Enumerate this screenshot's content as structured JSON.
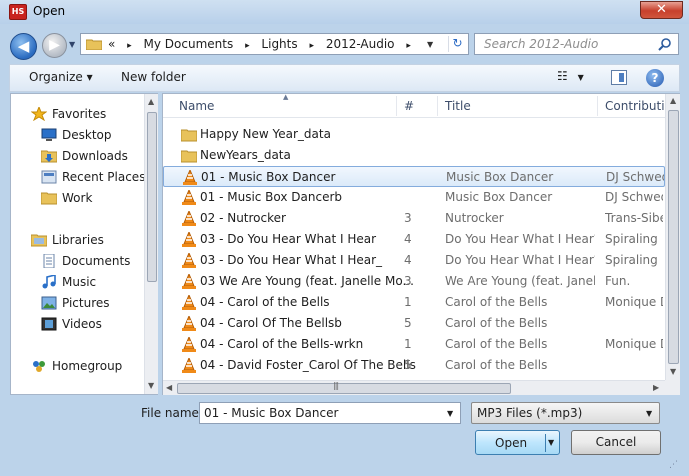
{
  "window": {
    "title": "Open",
    "icon_label": "HS",
    "close_label": "✕"
  },
  "nav": {
    "back_symbol": "◀",
    "forward_symbol": "▶"
  },
  "address": {
    "overflow": "«",
    "crumbs": [
      "My Documents",
      "Lights",
      "2012-Audio"
    ],
    "separator": "▸"
  },
  "search": {
    "placeholder": "Search 2012-Audio"
  },
  "toolbar": {
    "organize": "Organize ▾",
    "new_folder": "New folder",
    "help": "?"
  },
  "sidebar": {
    "items": [
      {
        "label": "Favorites",
        "icon": "star-icon"
      },
      {
        "label": "Desktop",
        "icon": "desktop-icon"
      },
      {
        "label": "Downloads",
        "icon": "downloads-icon"
      },
      {
        "label": "Recent Places",
        "icon": "recent-places-icon"
      },
      {
        "label": "Work",
        "icon": "folder-icon"
      },
      {
        "label": "Libraries",
        "icon": "library-icon"
      },
      {
        "label": "Documents",
        "icon": "documents-icon"
      },
      {
        "label": "Music",
        "icon": "music-icon"
      },
      {
        "label": "Pictures",
        "icon": "pictures-icon"
      },
      {
        "label": "Videos",
        "icon": "videos-icon"
      },
      {
        "label": "Homegroup",
        "icon": "homegroup-icon"
      }
    ]
  },
  "columns": {
    "name": "Name",
    "number": "#",
    "title": "Title",
    "contributing": "Contributin"
  },
  "files": [
    {
      "name": "Happy New Year_data",
      "num": "",
      "title": "",
      "contrib": "",
      "type": "folder"
    },
    {
      "name": "NewYears_data",
      "num": "",
      "title": "",
      "contrib": "",
      "type": "folder"
    },
    {
      "name": "01 - Music Box Dancer",
      "num": "",
      "title": "Music Box Dancer",
      "contrib": "DJ Schwed",
      "type": "audio"
    },
    {
      "name": "01 - Music Box Dancerb",
      "num": "",
      "title": "Music Box Dancer",
      "contrib": "DJ Schwed",
      "type": "audio"
    },
    {
      "name": "02 - Nutrocker",
      "num": "3",
      "title": "Nutrocker",
      "contrib": "Trans-Sibe",
      "type": "audio"
    },
    {
      "name": "03 - Do You Hear What I Hear",
      "num": "4",
      "title": "Do You Hear What I Hear?",
      "contrib": "Spiraling",
      "type": "audio"
    },
    {
      "name": "03 - Do You Hear What I Hear_",
      "num": "4",
      "title": "Do You Hear What I Hear?",
      "contrib": "Spiraling",
      "type": "audio"
    },
    {
      "name": "03 We Are Young (feat. Janelle Mo...",
      "num": "3",
      "title": "We Are Young (feat. Janel...",
      "contrib": "Fun.",
      "type": "audio"
    },
    {
      "name": "04 - Carol of the Bells",
      "num": "1",
      "title": "Carol of the Bells",
      "contrib": "Monique D",
      "type": "audio"
    },
    {
      "name": "04 - Carol Of The Bellsb",
      "num": "5",
      "title": "Carol of the Bells",
      "contrib": "",
      "type": "audio"
    },
    {
      "name": "04 - Carol of the Bells-wrkn",
      "num": "1",
      "title": "Carol of the Bells",
      "contrib": "Monique D",
      "type": "audio"
    },
    {
      "name": "04 - David Foster_Carol Of The Bells",
      "num": "5",
      "title": "Carol of the Bells",
      "contrib": "",
      "type": "audio"
    }
  ],
  "footer": {
    "filename_label": "File name:",
    "filename_value": "01 - Music Box Dancer",
    "filter_value": "MP3 Files (*.mp3)",
    "open_label": "Open",
    "cancel_label": "Cancel"
  }
}
